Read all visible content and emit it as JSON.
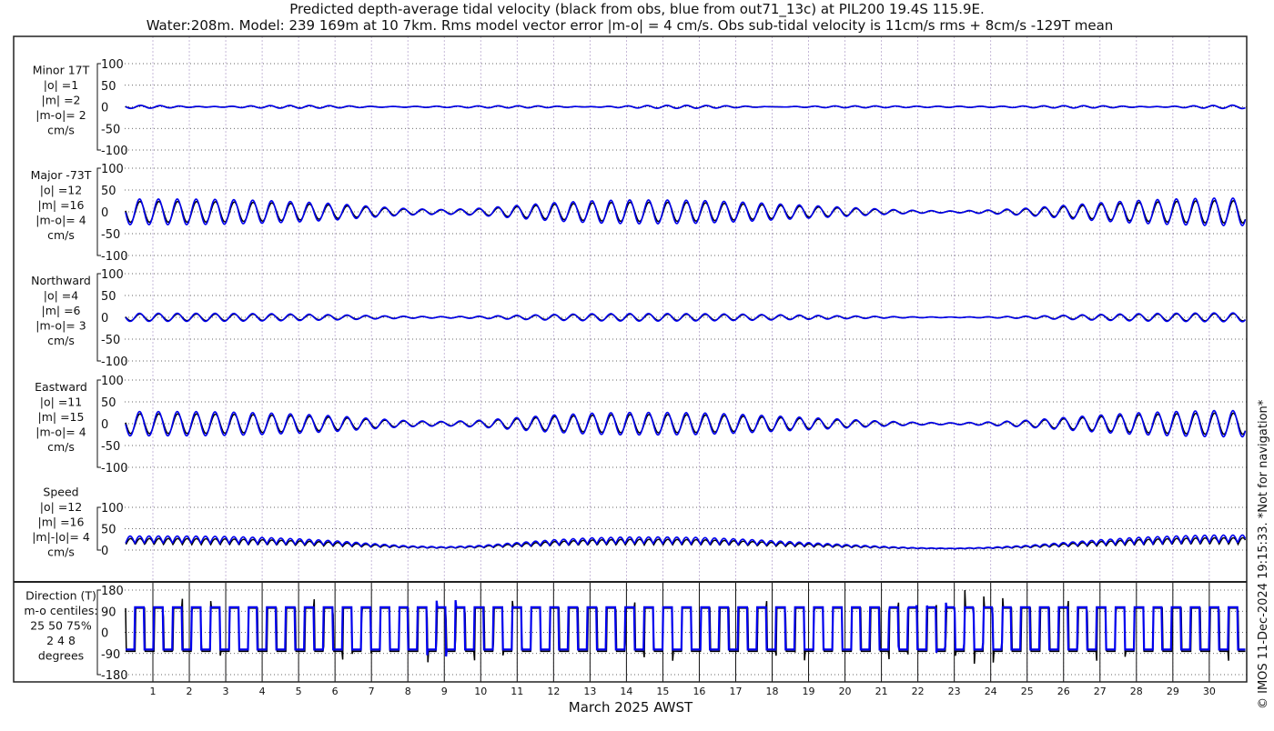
{
  "chart_data": {
    "type": "line",
    "title": "Predicted depth-average tidal velocity (black from obs, blue from out71_13c) at PIL200 19.4S 115.9E.",
    "subtitle": "Water:208m. Model: 239 169m at 10 7km. Rms model vector error |m-o| = 4 cm/s. Obs sub-tidal velocity is 11cm/s rms + 8cm/s -129T mean",
    "xlabel": "March 2025 AWST",
    "x_ticks": [
      "1",
      "2",
      "3",
      "4",
      "5",
      "6",
      "7",
      "8",
      "9",
      "10",
      "11",
      "12",
      "13",
      "14",
      "15",
      "16",
      "17",
      "18",
      "19",
      "20",
      "21",
      "22",
      "23",
      "24",
      "25",
      "26",
      "27",
      "28",
      "29",
      "30"
    ],
    "xlim_days": [
      0.25,
      31
    ],
    "grid": true,
    "colors": {
      "obs": "#000000",
      "model": "#0000ee",
      "grid": "#b9a8cf"
    },
    "tidal_period_hours": 12.42,
    "daily_amplitude_major_cm_s": [
      28,
      28,
      28,
      27,
      25,
      22,
      18,
      12,
      7,
      5,
      8,
      14,
      20,
      24,
      26,
      26,
      25,
      22,
      18,
      14,
      10,
      6,
      3,
      2,
      4,
      8,
      14,
      20,
      25,
      28,
      30,
      30
    ],
    "panels": [
      {
        "lines": [
          "Minor 17T",
          "|o| =1",
          "|m| =2",
          "|m-o|= 2",
          "cm/s"
        ],
        "yticks": [
          "100",
          "50",
          "0",
          "-50",
          "-100"
        ],
        "ylim": [
          -100,
          100
        ],
        "scale": 0.08
      },
      {
        "lines": [
          "Major -73T",
          "|o| =12",
          "|m| =16",
          "|m-o|= 4",
          "cm/s"
        ],
        "yticks": [
          "100",
          "50",
          "0",
          "-50",
          "-100"
        ],
        "ylim": [
          -100,
          100
        ],
        "scale": 1.0
      },
      {
        "lines": [
          "Northward",
          "|o| =4",
          "|m| =6",
          "|m-o|= 3",
          "cm/s"
        ],
        "yticks": [
          "100",
          "50",
          "0",
          "-50",
          "-100"
        ],
        "ylim": [
          -100,
          100
        ],
        "scale": 0.32
      },
      {
        "lines": [
          "Eastward",
          "|o| =11",
          "|m| =15",
          "|m-o|= 4",
          "cm/s"
        ],
        "yticks": [
          "100",
          "50",
          "0",
          "-50",
          "-100"
        ],
        "ylim": [
          -100,
          100
        ],
        "scale": 0.95
      },
      {
        "lines": [
          "Speed",
          "|o| =12",
          "|m| =16",
          "|m|-|o|= 4",
          "cm/s"
        ],
        "yticks": [
          "100",
          "50",
          "0"
        ],
        "ylim": [
          0,
          100
        ],
        "scale": 1.0,
        "kind": "speed"
      },
      {
        "lines": [
          "Direction (T)",
          "m-o centiles:",
          "25  50  75%",
          "2  4  8",
          "degrees"
        ],
        "yticks": [
          "180",
          "90",
          "0",
          "-90",
          "-180"
        ],
        "ylim": [
          -180,
          180
        ],
        "kind": "direction",
        "directions_deg": [
          107,
          -73
        ]
      }
    ],
    "footer": "© IMOS 11-Dec-2024 19:15:33. *Not for navigation*"
  }
}
